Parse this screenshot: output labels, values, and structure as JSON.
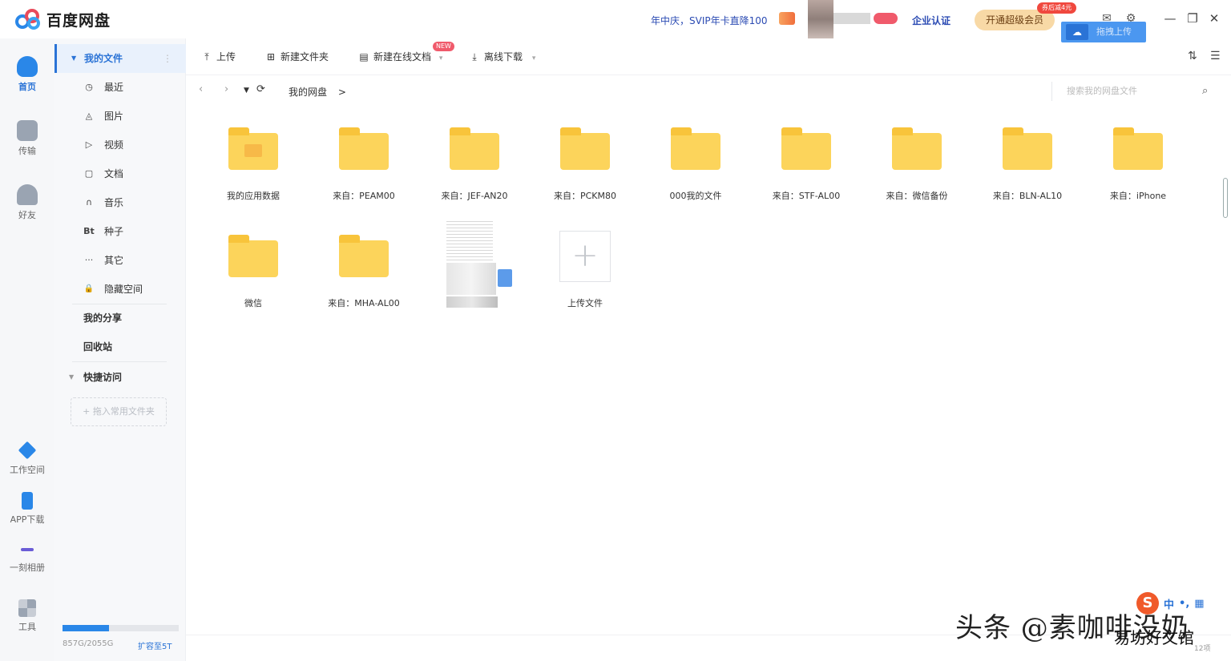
{
  "app": {
    "name": "百度网盘"
  },
  "header": {
    "promo": "年中庆，SVIP年卡直降100",
    "enterprise": "企业认证",
    "open_vip": "开通超级会员",
    "discount": "券后减4元",
    "drag_upload": "拖拽上传"
  },
  "rail": [
    {
      "label": "首页",
      "color": "#2a87e8"
    },
    {
      "label": "传输",
      "color": "#9aa4b2"
    },
    {
      "label": "好友",
      "color": "#9aa4b2"
    },
    {
      "label": "工作空间",
      "color": "#2a87e8"
    },
    {
      "label": "APP下载",
      "color": "#2a87e8"
    },
    {
      "label": "一刻相册",
      "color": "#6a5cd6"
    },
    {
      "label": "工具",
      "color": "#9aa4b2"
    }
  ],
  "sidebar": {
    "my_files": "我的文件",
    "items": [
      {
        "icon": "◷",
        "label": "最近"
      },
      {
        "icon": "◬",
        "label": "图片"
      },
      {
        "icon": "▷",
        "label": "视频"
      },
      {
        "icon": "▢",
        "label": "文档"
      },
      {
        "icon": "∩",
        "label": "音乐"
      },
      {
        "icon": "Bt",
        "label": "种子"
      },
      {
        "icon": "···",
        "label": "其它"
      },
      {
        "icon": "🔒",
        "label": "隐藏空间"
      }
    ],
    "my_share": "我的分享",
    "recycle": "回收站",
    "quick_access": "快捷访问",
    "quick_add": "+ 拖入常用文件夹",
    "storage": {
      "text": "857G/2055G",
      "used_fraction": 0.4,
      "expand": "扩容至5T"
    }
  },
  "toolbar": {
    "upload": "上传",
    "new_folder": "新建文件夹",
    "new_doc": "新建在线文档",
    "new_tag": "NEW",
    "offline": "离线下载"
  },
  "nav": {
    "breadcrumb": "我的网盘",
    "breadcrumb_sep": ">",
    "search_placeholder": "搜索我的网盘文件"
  },
  "files": [
    {
      "type": "app-folder",
      "name": "我的应用数据"
    },
    {
      "type": "folder",
      "name": "来自：PEAM00"
    },
    {
      "type": "folder",
      "name": "来自：JEF-AN20"
    },
    {
      "type": "folder",
      "name": "来自：PCKM80"
    },
    {
      "type": "folder",
      "name": "000我的文件"
    },
    {
      "type": "folder",
      "name": "来自：STF-AL00"
    },
    {
      "type": "folder",
      "name": "来自：微信备份"
    },
    {
      "type": "folder",
      "name": "来自：BLN-AL10"
    },
    {
      "type": "folder",
      "name": "来自：iPhone"
    },
    {
      "type": "folder",
      "name": "微信"
    },
    {
      "type": "folder",
      "name": "来自：MHA-AL00"
    },
    {
      "type": "doc",
      "name": ""
    },
    {
      "type": "upload",
      "name": "上传文件"
    }
  ],
  "overlay": {
    "watermark": "头条 @素咖啡没奶",
    "watermark2": "易坊好文馆",
    "ime_lang": "中",
    "count": "12项"
  }
}
